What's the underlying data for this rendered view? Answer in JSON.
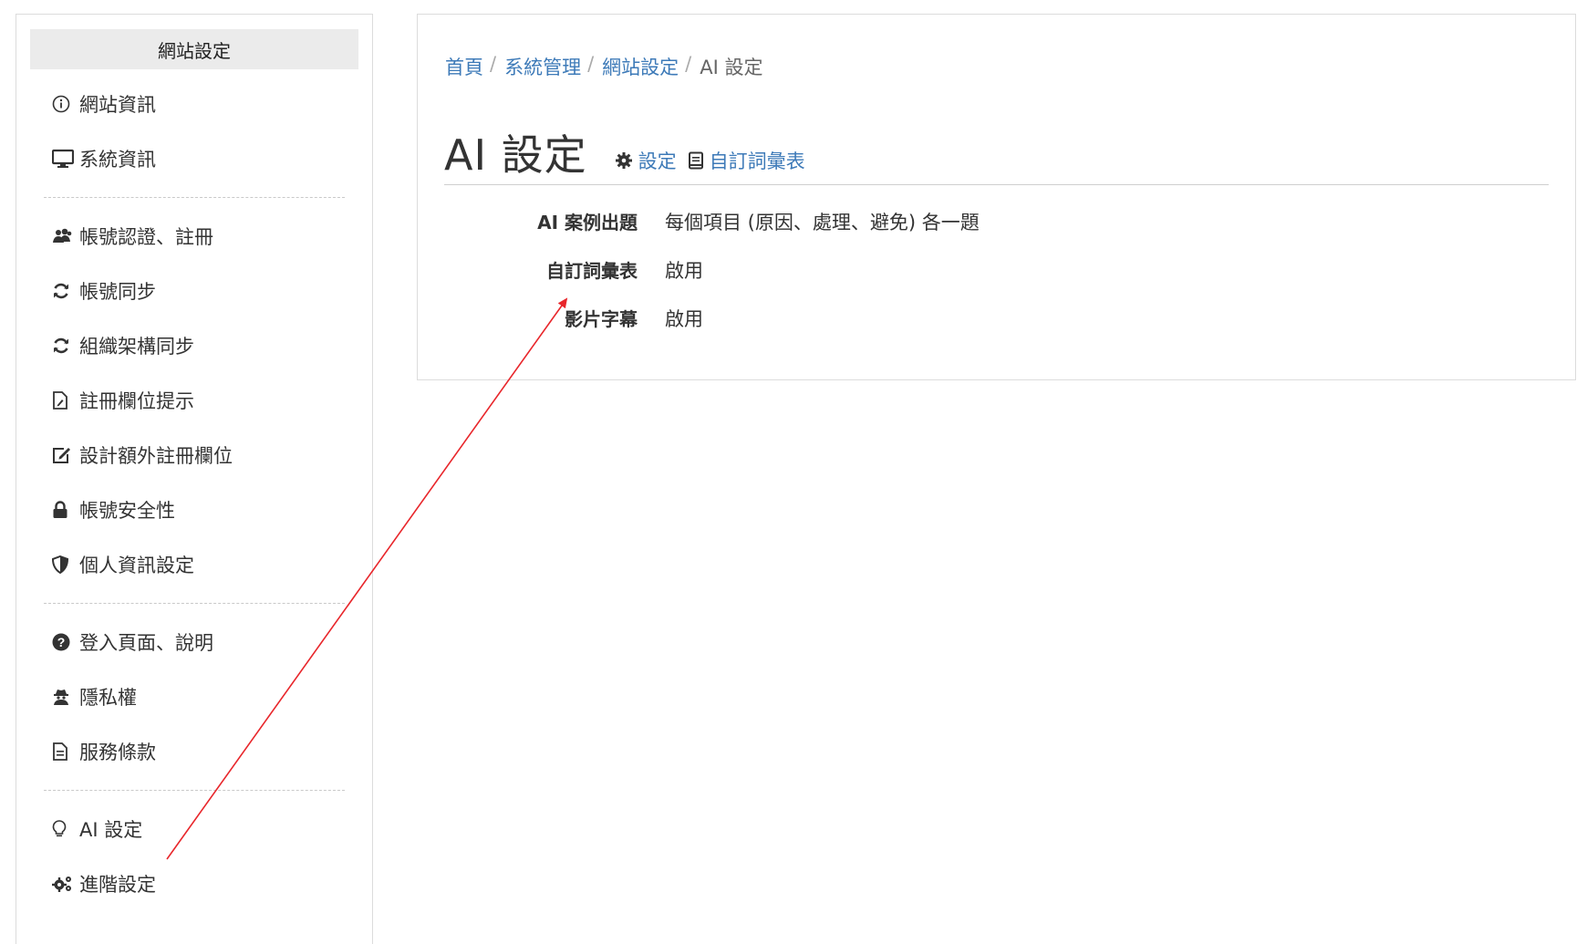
{
  "sidebar": {
    "title": "網站設定",
    "groups": [
      [
        {
          "label": "網站資訊",
          "icon": "info-circle-icon"
        },
        {
          "label": "系統資訊",
          "icon": "desktop-icon"
        }
      ],
      [
        {
          "label": "帳號認證、註冊",
          "icon": "users-icon"
        },
        {
          "label": "帳號同步",
          "icon": "sync-icon"
        },
        {
          "label": "組織架構同步",
          "icon": "sync-icon"
        },
        {
          "label": "註冊欄位提示",
          "icon": "file-signature-icon"
        },
        {
          "label": "設計額外註冊欄位",
          "icon": "edit-icon"
        },
        {
          "label": "帳號安全性",
          "icon": "lock-icon"
        },
        {
          "label": "個人資訊設定",
          "icon": "shield-icon"
        }
      ],
      [
        {
          "label": "登入頁面、說明",
          "icon": "question-circle-icon"
        },
        {
          "label": "隱私權",
          "icon": "user-secret-icon"
        },
        {
          "label": "服務條款",
          "icon": "file-text-icon"
        }
      ],
      [
        {
          "label": "AI 設定",
          "icon": "lightbulb-icon"
        },
        {
          "label": "進階設定",
          "icon": "cogs-icon"
        }
      ]
    ]
  },
  "breadcrumb": {
    "items": [
      "首頁",
      "系統管理",
      "網站設定"
    ],
    "current": "AI 設定",
    "separator": "/"
  },
  "page": {
    "title": "AI 設定",
    "links": [
      {
        "label": "設定",
        "icon": "gear-icon"
      },
      {
        "label": "自訂詞彙表",
        "icon": "book-icon"
      }
    ]
  },
  "settings": [
    {
      "key": "AI 案例出題",
      "value": "每個項目 (原因、處理、避免) 各一題"
    },
    {
      "key": "自訂詞彙表",
      "value": "啟用"
    },
    {
      "key": "影片字幕",
      "value": "啟用"
    }
  ],
  "colors": {
    "link": "#3d7ab8",
    "annotation_arrow": "#e8262b",
    "sidebar_header_bg": "#ebebeb"
  }
}
